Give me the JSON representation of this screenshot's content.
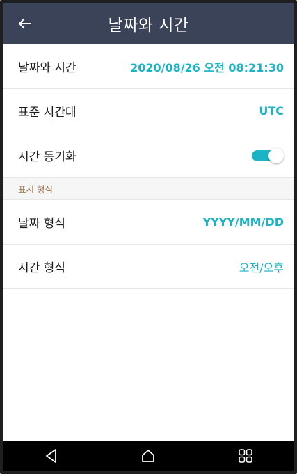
{
  "header": {
    "title": "날짜와 시간",
    "back_icon": "arrow-left-icon"
  },
  "settings": {
    "date_time": {
      "label": "날짜와 시간",
      "value": "2020/08/26 오전 08:21:30"
    },
    "timezone": {
      "label": "표준 시간대",
      "value": "UTC"
    },
    "time_sync": {
      "label": "시간 동기화",
      "enabled": true
    }
  },
  "display_format": {
    "section_label": "표시 형식",
    "date_format": {
      "label": "날짜 형식",
      "value": "YYYY/MM/DD"
    },
    "time_format": {
      "label": "시간 형식",
      "value": "오전/오후"
    }
  },
  "navbar": {
    "icons": [
      "back-triangle-icon",
      "home-icon",
      "recent-apps-icon"
    ]
  },
  "colors": {
    "header_bg": "#3a4358",
    "accent": "#1bb3c6",
    "section_text": "#a07a52",
    "navbar_bg": "#000000"
  }
}
